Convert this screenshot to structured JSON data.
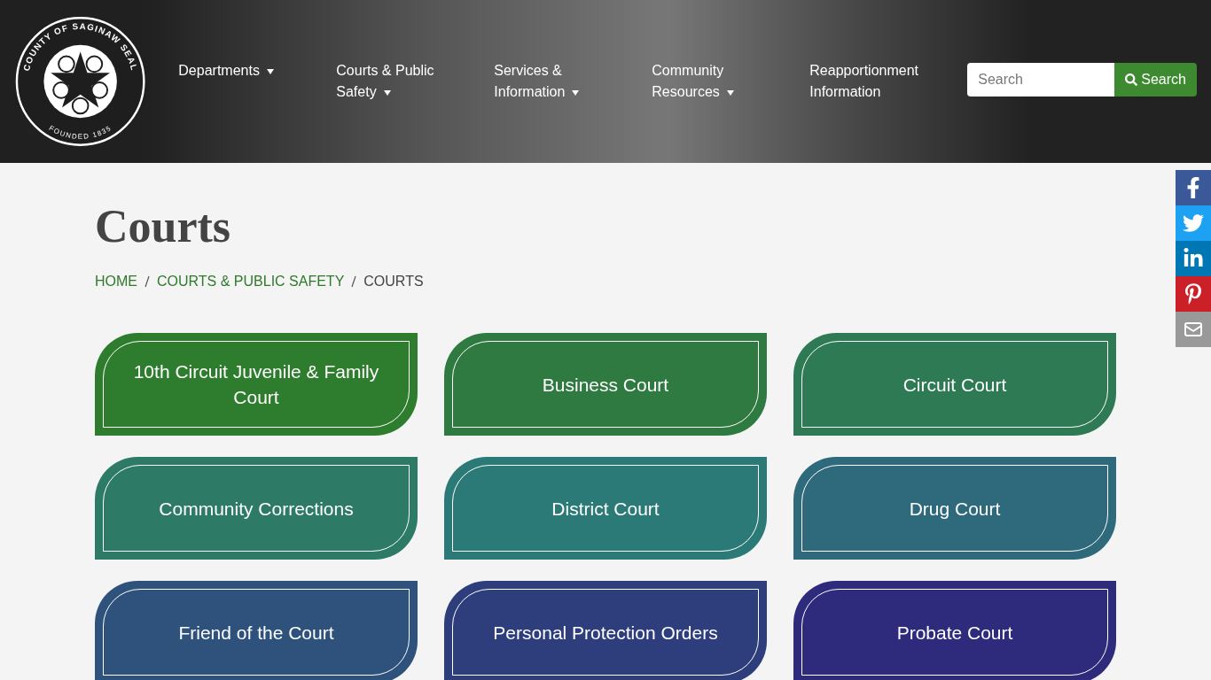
{
  "logo": {
    "top_text": "COUNTY OF SAGINAW SEAL",
    "bottom_text": "FOUNDED 1835"
  },
  "nav": [
    {
      "label": "Departments",
      "dropdown": true
    },
    {
      "label": "Courts & Public Safety",
      "dropdown": true
    },
    {
      "label": "Services & Information",
      "dropdown": true
    },
    {
      "label": "Community Resources",
      "dropdown": true
    },
    {
      "label": "Reapportionment Information",
      "dropdown": false
    }
  ],
  "search": {
    "placeholder": "Search",
    "button": "Search"
  },
  "page_title": "Courts",
  "breadcrumb": [
    {
      "label": "HOME",
      "current": false
    },
    {
      "label": "COURTS & PUBLIC SAFETY",
      "current": false
    },
    {
      "label": "COURTS",
      "current": true
    }
  ],
  "tiles": [
    {
      "label": "10th Circuit Juvenile & Family Court",
      "color": "#2e7d2e"
    },
    {
      "label": "Business Court",
      "color": "#2e7a40"
    },
    {
      "label": "Circuit Court",
      "color": "#2d7a55"
    },
    {
      "label": "Community Corrections",
      "color": "#2d7a66"
    },
    {
      "label": "District Court",
      "color": "#2c7a78"
    },
    {
      "label": "Drug Court",
      "color": "#2e6a7c"
    },
    {
      "label": "Friend of the Court",
      "color": "#2e527c"
    },
    {
      "label": "Personal Protection Orders",
      "color": "#2e3e7c"
    },
    {
      "label": "Probate Court",
      "color": "#2e2a7c"
    }
  ],
  "share": [
    {
      "kind": "facebook"
    },
    {
      "kind": "twitter"
    },
    {
      "kind": "linkedin"
    },
    {
      "kind": "pinterest"
    },
    {
      "kind": "email"
    }
  ]
}
